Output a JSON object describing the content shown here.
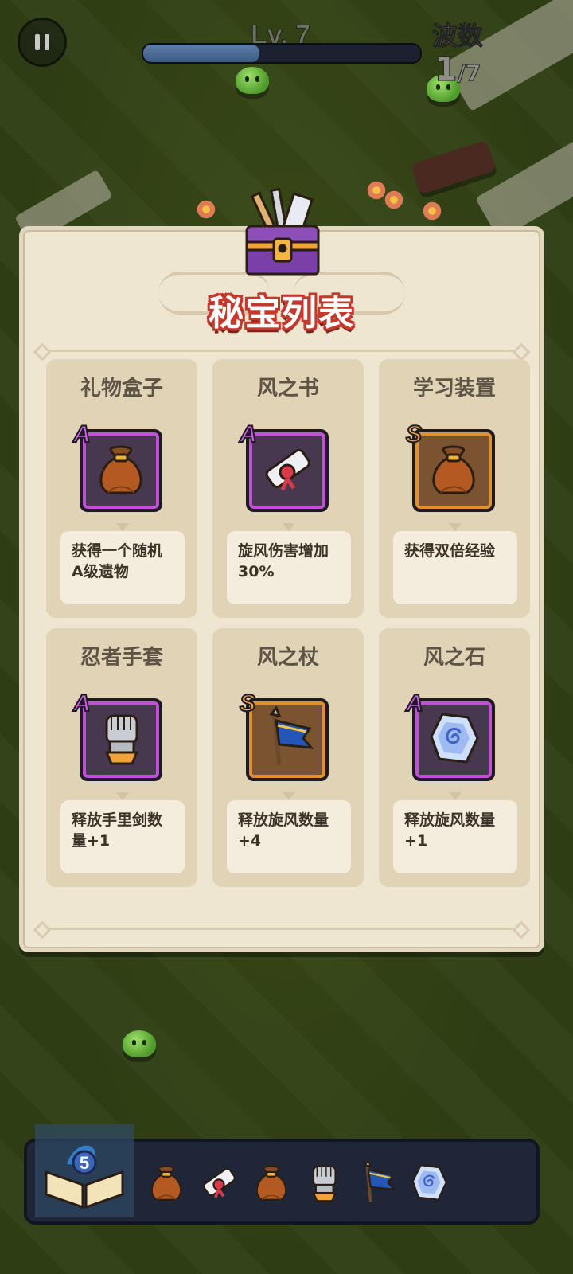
{
  "hud": {
    "level_label": "Lv. 7",
    "xp_progress": 0.42,
    "wave_label": "波数",
    "wave_current": "1",
    "wave_total": "/7"
  },
  "panel": {
    "title": "秘宝列表",
    "items": [
      {
        "name": "礼物盒子",
        "grade": "A",
        "icon": "treasure-bag-icon",
        "desc": "获得一个随机A级遗物"
      },
      {
        "name": "风之书",
        "grade": "A",
        "icon": "scroll-icon",
        "desc": "旋风伤害增加30%"
      },
      {
        "name": "学习装置",
        "grade": "S",
        "icon": "treasure-bag-icon",
        "desc": "获得双倍经验"
      },
      {
        "name": "忍者手套",
        "grade": "A",
        "icon": "gauntlet-icon",
        "desc": "释放手里剑数量+1"
      },
      {
        "name": "风之杖",
        "grade": "S",
        "icon": "flag-staff-icon",
        "desc": "释放旋风数量+4"
      },
      {
        "name": "风之石",
        "grade": "A",
        "icon": "rune-stone-icon",
        "desc": "释放旋风数量+1"
      }
    ]
  },
  "bottom_bar": {
    "book_count": "5",
    "tray_icons": [
      "treasure-bag-icon",
      "scroll-icon",
      "treasure-bag-icon",
      "gauntlet-icon",
      "flag-staff-icon",
      "rune-stone-icon"
    ]
  },
  "colors": {
    "grade_a": "#c14fd8",
    "grade_s": "#e0912d",
    "title_outline": "#c4392c"
  }
}
